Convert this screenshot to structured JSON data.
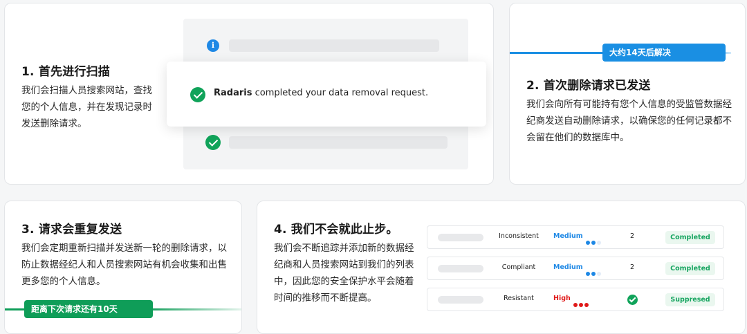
{
  "step1": {
    "title": "1. 首先进行扫描",
    "desc": "我们会扫描人员搜索网站，查找您的个人信息，并在发现记录时发送删除请求。",
    "info_icon": "info-icon",
    "notification": {
      "broker": "Radaris",
      "message": "completed your data removal request."
    }
  },
  "step2": {
    "badge": "大约14天后解决",
    "title": "2. 首次删除请求已发送",
    "desc": "我们会向所有可能持有您个人信息的受监管数据经纪商发送自动删除请求，以确保您的任何记录都不会留在他们的数据库中。"
  },
  "step3": {
    "title": "3. 请求会重复发送",
    "desc": "我们会定期重新扫描并发送新一轮的删除请求，以防止数据经纪人和人员搜索网站有机会收集和出售更多您的个人信息。",
    "badge": "距离下次请求还有10天"
  },
  "step4": {
    "title": "4. 我们不会就此止步。",
    "desc": "我们会不断追踪并添加新的数据经纪商和人员搜索网站到我们的列表中，因此您的安全保护水平会随着时间的推移而不断提高。",
    "rows": [
      {
        "status": "Inconsistent",
        "level": "Medium",
        "level_dots": 2,
        "count": "2",
        "result": "Completed"
      },
      {
        "status": "Compliant",
        "level": "Medium",
        "level_dots": 2,
        "count": "2",
        "result": "Completed"
      },
      {
        "status": "Resistant",
        "level": "High",
        "level_dots": 3,
        "count": null,
        "result": "Suppresed"
      }
    ]
  },
  "colors": {
    "blue": "#1a8fe3",
    "green": "#0f9d58",
    "medium": "#1e88e5",
    "high": "#e01919"
  }
}
